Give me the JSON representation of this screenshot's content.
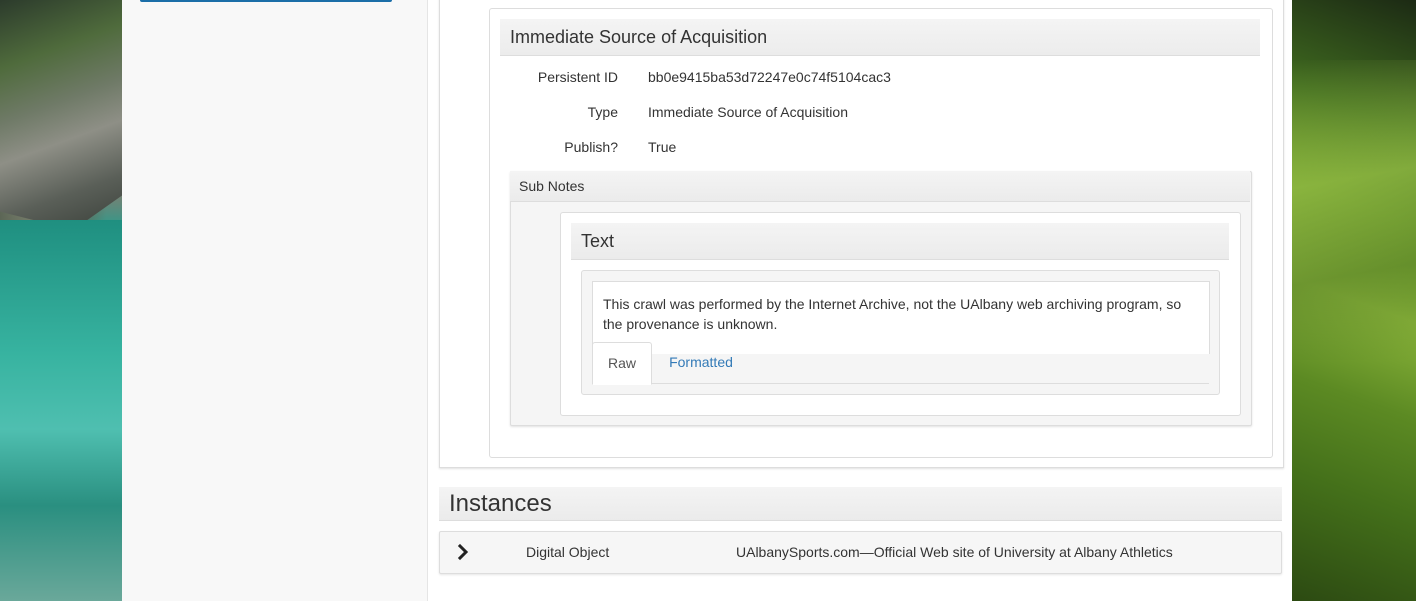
{
  "note": {
    "heading": "Immediate Source of Acquisition",
    "fields": [
      {
        "label": "Persistent ID",
        "value": "bb0e9415ba53d72247e0c74f5104cac3"
      },
      {
        "label": "Type",
        "value": "Immediate Source of Acquisition"
      },
      {
        "label": "Publish?",
        "value": "True"
      }
    ],
    "subnotes": {
      "heading": "Sub Notes",
      "text_card": {
        "heading": "Text",
        "content": "This crawl was performed by the Internet Archive, not the UAlbany web archiving program, so the provenance is unknown.",
        "tabs": [
          {
            "label": "Raw",
            "active": true
          },
          {
            "label": "Formatted",
            "active": false
          }
        ]
      }
    }
  },
  "instances": {
    "heading": "Instances",
    "rows": [
      {
        "type": "Digital Object",
        "title": "UAlbanySports.com—Official Web site of University at Albany Athletics",
        "icon": "chevron-right-icon"
      }
    ]
  },
  "colors": {
    "link": "#337ab7",
    "accent_button": "#1b6ea8"
  }
}
